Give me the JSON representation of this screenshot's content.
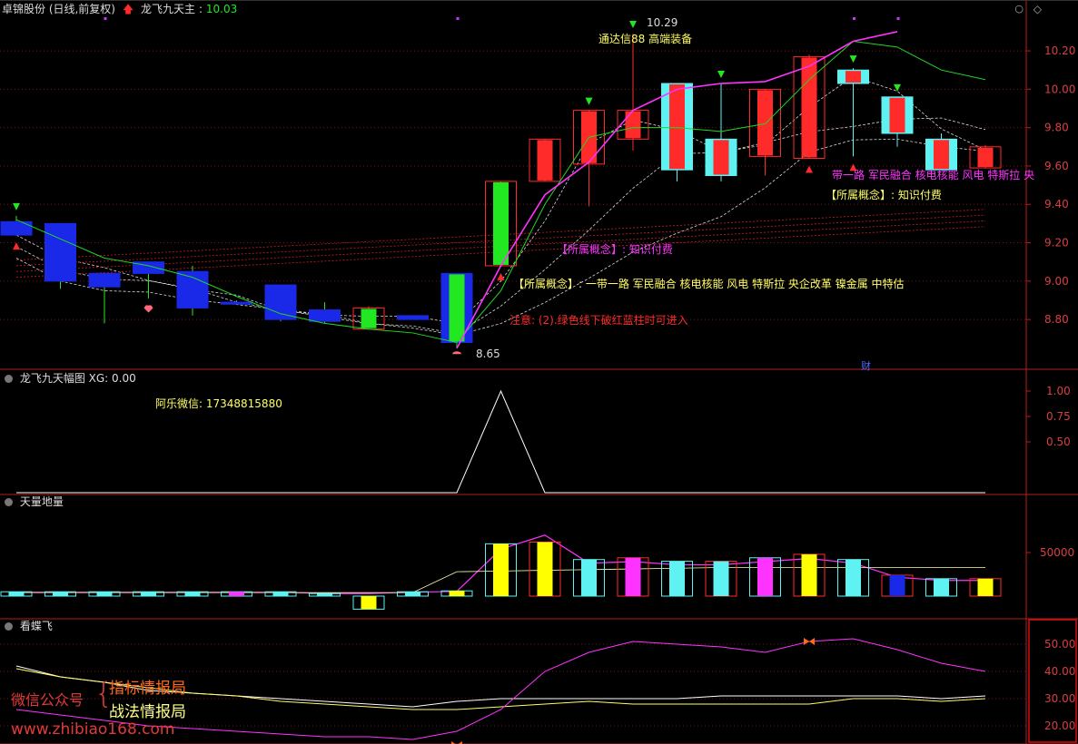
{
  "panel1": {
    "stock_name": "卓锦股份 (日线,前复权)",
    "indicator_name": "龙飞九天主",
    "indicator_value": "10.03",
    "high_label": "10.29",
    "low_label": "8.65",
    "caiwu_badge": "财",
    "annotations": {
      "tdx88": "通达信88 高端装备",
      "concept_top_tail": "带一路 军民融合 核电核能 风电 特斯拉 央",
      "concept_top_head": "【所属概念】: 知识付费",
      "concept_mid": "【所属概念】: 知识付费",
      "concept_main": "【所属概念】: 一带一路 军民融合 核电核能 风电 特斯拉 央企改革 镍金属 中特估",
      "note": "注意: (2).绿色线下破红蓝柱时可进入"
    }
  },
  "panel2": {
    "title": "龙飞九天幅图 XG: 0.00",
    "wechat_text": "阿乐微信: 17348815880"
  },
  "panel3": {
    "title": "天量地量"
  },
  "panel4": {
    "title": "看蝶飞"
  },
  "watermark": {
    "label": "微信公众号",
    "line1": "指标情报局",
    "line2": "战法情报局",
    "site": "www.zhibiao168.com"
  },
  "colors": {
    "up": "#ff2a2a",
    "down_fill": "#5ef2f2",
    "blue": "#1a28e8",
    "green": "#22e822",
    "magenta": "#ff33ff",
    "yellow": "#ffff00",
    "axis": "#b41e1e"
  },
  "chart_data": [
    {
      "type": "candlestick",
      "title": "卓锦股份 (日线,前复权)",
      "ylim": [
        8.55,
        10.38
      ],
      "y_ticks": [
        8.8,
        9.0,
        9.2,
        9.4,
        9.6,
        9.8,
        10.0,
        10.2
      ],
      "candles": [
        {
          "o": 9.31,
          "h": 9.34,
          "l": 9.24,
          "c": 9.24
        },
        {
          "o": 9.3,
          "h": 9.3,
          "l": 8.96,
          "c": 9.0
        },
        {
          "o": 9.04,
          "h": 9.04,
          "l": 8.78,
          "c": 8.97
        },
        {
          "o": 9.1,
          "h": 9.1,
          "l": 8.91,
          "c": 9.04
        },
        {
          "o": 9.05,
          "h": 9.08,
          "l": 8.82,
          "c": 8.86
        },
        {
          "o": 8.89,
          "h": 8.9,
          "l": 8.88,
          "c": 8.88
        },
        {
          "o": 8.98,
          "h": 8.98,
          "l": 8.79,
          "c": 8.8
        },
        {
          "o": 8.85,
          "h": 8.89,
          "l": 8.78,
          "c": 8.79
        },
        {
          "o": 8.75,
          "h": 8.87,
          "l": 8.75,
          "c": 8.86
        },
        {
          "o": 8.82,
          "h": 8.82,
          "l": 8.8,
          "c": 8.8
        },
        {
          "o": 9.04,
          "h": 9.04,
          "l": 8.65,
          "c": 8.68
        },
        {
          "o": 9.08,
          "h": 9.52,
          "l": 9.08,
          "c": 9.52
        },
        {
          "o": 9.52,
          "h": 9.74,
          "l": 9.52,
          "c": 9.74
        },
        {
          "o": 9.61,
          "h": 9.89,
          "l": 9.39,
          "c": 9.89
        },
        {
          "o": 9.74,
          "h": 10.29,
          "l": 9.68,
          "c": 9.89
        },
        {
          "o": 10.03,
          "h": 10.03,
          "l": 9.52,
          "c": 9.58
        },
        {
          "o": 9.74,
          "h": 10.03,
          "l": 9.52,
          "c": 9.55
        },
        {
          "o": 9.65,
          "h": 10.0,
          "l": 9.55,
          "c": 10.0
        },
        {
          "o": 9.64,
          "h": 10.18,
          "l": 9.64,
          "c": 10.17
        },
        {
          "o": 10.1,
          "h": 10.11,
          "l": 9.65,
          "c": 10.03
        },
        {
          "o": 9.96,
          "h": 9.96,
          "l": 9.7,
          "c": 9.77
        },
        {
          "o": 9.74,
          "h": 9.77,
          "l": 9.58,
          "c": 9.58
        },
        {
          "o": 9.59,
          "h": 9.71,
          "l": 9.59,
          "c": 9.7
        }
      ],
      "green_line": [
        9.32,
        9.22,
        9.12,
        9.08,
        9.02,
        8.92,
        8.83,
        8.78,
        8.75,
        8.73,
        8.68,
        8.95,
        9.4,
        9.75,
        9.8,
        9.8,
        9.78,
        9.82,
        10.05,
        10.25,
        10.22,
        10.1,
        10.05
      ],
      "magenta_line_from_index": 10,
      "magenta_line": [
        8.65,
        9.08,
        9.45,
        9.62,
        9.89,
        10.0,
        10.03,
        10.04,
        10.12,
        10.25,
        10.3
      ]
    },
    {
      "type": "line",
      "title": "龙飞九天幅图 XG: 0.00",
      "ylim": [
        0,
        1.0
      ],
      "y_ticks": [
        0.5,
        0.75,
        1.0
      ],
      "values": [
        0,
        0,
        0,
        0,
        0,
        0,
        0,
        0,
        0,
        0,
        0,
        1.0,
        0,
        0,
        0,
        0,
        0,
        0,
        0,
        0,
        0,
        0,
        0
      ]
    },
    {
      "type": "bar",
      "title": "天量地量",
      "y_ticks": [
        50000
      ],
      "values": [
        5000,
        5000,
        5000,
        5000,
        5000,
        5000,
        5000,
        3000,
        -15000,
        5000,
        6000,
        60000,
        62000,
        42000,
        44000,
        40000,
        40000,
        44000,
        48000,
        42000,
        24000,
        20000,
        20000
      ]
    },
    {
      "type": "line",
      "title": "看蝶飞",
      "ylim": [
        14,
        59
      ],
      "y_ticks": [
        20.0,
        30.0,
        40.0,
        50.0
      ],
      "series": [
        {
          "values": [
            42,
            38,
            36,
            33,
            32,
            31,
            30,
            29,
            28,
            27,
            29,
            30,
            30,
            30,
            30,
            30,
            31,
            31,
            31,
            31,
            31,
            30,
            31
          ]
        },
        {
          "values": [
            41,
            38,
            36,
            34,
            32,
            31,
            29,
            28,
            27,
            26,
            26,
            27,
            28,
            29,
            28,
            28,
            28,
            28,
            28,
            30,
            30,
            29,
            30
          ]
        },
        {
          "values": [
            26,
            24,
            22,
            20,
            19,
            18,
            17,
            16,
            16,
            15,
            18,
            26,
            40,
            47,
            51,
            50,
            49,
            47,
            51,
            52,
            48,
            43,
            40
          ]
        }
      ]
    }
  ]
}
